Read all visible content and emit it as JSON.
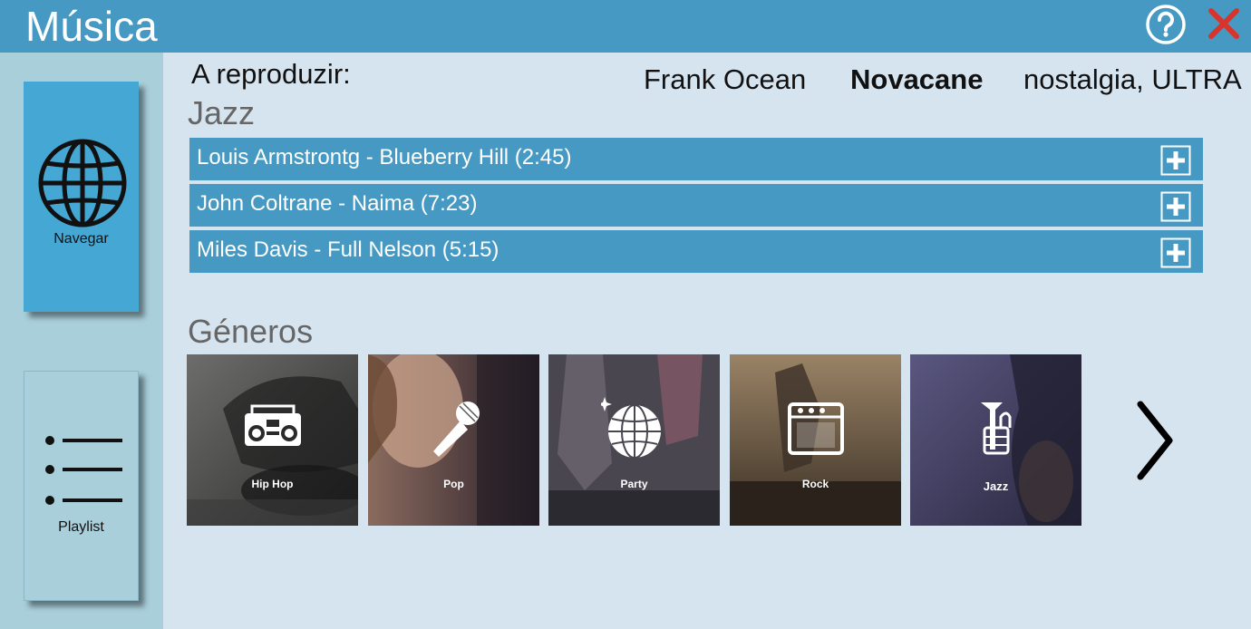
{
  "app": {
    "title": "Música"
  },
  "titlebar": {
    "help_icon": "help-circle-icon",
    "close_icon": "close-icon",
    "close_color": "#d9342b"
  },
  "sidebar": {
    "nav": {
      "label": "Navegar",
      "icon": "globe-icon"
    },
    "playlist": {
      "label": "Playlist",
      "icon": "list-icon"
    }
  },
  "now_playing": {
    "label": "A reproduzir:",
    "artist": "Frank Ocean",
    "track": "Novacane",
    "album": "nostalgia, ULTRA"
  },
  "jazz": {
    "title": "Jazz",
    "songs": [
      {
        "label": "Louis Armstrontg - Blueberry Hill (2:45)"
      },
      {
        "label": "John Coltrane - Naima (7:23)"
      },
      {
        "label": "Miles Davis - Full Nelson (5:15)"
      }
    ]
  },
  "genres": {
    "title": "Géneros",
    "items": [
      {
        "label": "Hip Hop",
        "icon": "boombox-icon"
      },
      {
        "label": "Pop",
        "icon": "microphone-icon"
      },
      {
        "label": "Party",
        "icon": "disco-ball-icon"
      },
      {
        "label": "Rock",
        "icon": "amplifier-icon"
      },
      {
        "label": "Jazz",
        "icon": "saxophone-icon"
      }
    ],
    "next_icon": "chevron-right-icon"
  },
  "colors": {
    "accent": "#4599c2",
    "background": "#d6e4f0",
    "sidebar": "#a9cfdb"
  }
}
